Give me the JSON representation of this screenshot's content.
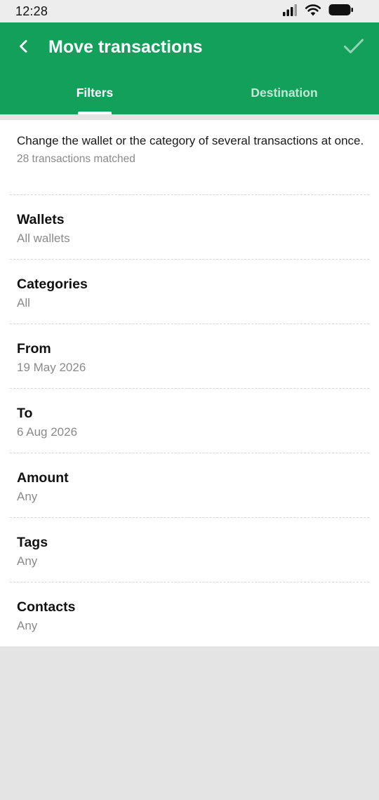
{
  "status_bar": {
    "time": "12:28",
    "icons": [
      "signal-icon",
      "wifi-icon",
      "battery-icon"
    ]
  },
  "header": {
    "title": "Move transactions",
    "back_icon": "chevron-left-icon",
    "confirm_icon": "check-icon",
    "background_color": "#12a05a"
  },
  "tabs": [
    {
      "label": "Filters",
      "active": true
    },
    {
      "label": "Destination",
      "active": false
    }
  ],
  "intro": {
    "description": "Change the wallet or the category of several transactions at once.",
    "matched": "28 transactions matched"
  },
  "filters": [
    {
      "label": "Wallets",
      "value": "All wallets"
    },
    {
      "label": "Categories",
      "value": "All"
    },
    {
      "label": "From",
      "value": "19 May 2026"
    },
    {
      "label": "To",
      "value": "6 Aug 2026"
    },
    {
      "label": "Amount",
      "value": "Any"
    },
    {
      "label": "Tags",
      "value": "Any"
    },
    {
      "label": "Contacts",
      "value": "Any"
    }
  ]
}
